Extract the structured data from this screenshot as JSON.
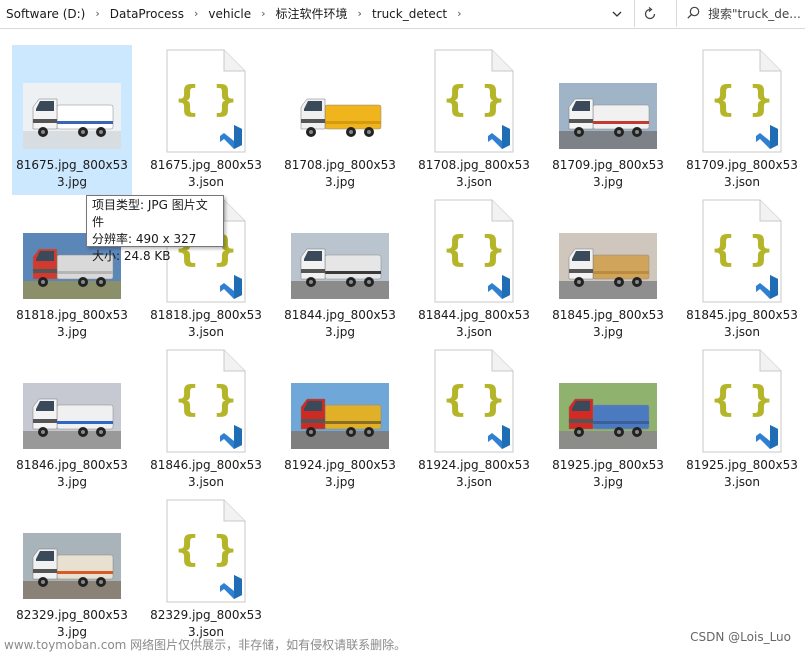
{
  "breadcrumb": [
    "Software (D:)",
    "DataProcess",
    "vehicle",
    "标注软件环境",
    "truck_detect"
  ],
  "search": {
    "placeholder": "搜索\"truck_de..."
  },
  "files": [
    {
      "name": "81675.jpg_800x533.jpg",
      "type": "jpg",
      "selected": true,
      "truck": "white-sweeper"
    },
    {
      "name": "81675.jpg_800x533.json",
      "type": "json"
    },
    {
      "name": "81708.jpg_800x533.jpg",
      "type": "jpg",
      "truck": "yellow-sweeper"
    },
    {
      "name": "81708.jpg_800x533.json",
      "type": "json"
    },
    {
      "name": "81709.jpg_800x533.jpg",
      "type": "jpg",
      "truck": "white-sweeper-2"
    },
    {
      "name": "81709.jpg_800x533.json",
      "type": "json"
    },
    {
      "name": "81818.jpg_800x533.jpg",
      "type": "jpg",
      "truck": "tanker-long"
    },
    {
      "name": "81818.jpg_800x533.json",
      "type": "json"
    },
    {
      "name": "81844.jpg_800x533.jpg",
      "type": "jpg",
      "truck": "white-box"
    },
    {
      "name": "81844.jpg_800x533.json",
      "type": "json"
    },
    {
      "name": "81845.jpg_800x533.jpg",
      "type": "jpg",
      "truck": "white-sweeper-3"
    },
    {
      "name": "81845.jpg_800x533.json",
      "type": "json"
    },
    {
      "name": "81846.jpg_800x533.jpg",
      "type": "jpg",
      "truck": "white-front"
    },
    {
      "name": "81846.jpg_800x533.json",
      "type": "json"
    },
    {
      "name": "81924.jpg_800x533.jpg",
      "type": "jpg",
      "truck": "red-crane"
    },
    {
      "name": "81924.jpg_800x533.json",
      "type": "json"
    },
    {
      "name": "81925.jpg_800x533.jpg",
      "type": "jpg",
      "truck": "red-flatbed"
    },
    {
      "name": "81925.jpg_800x533.json",
      "type": "json"
    },
    {
      "name": "82329.jpg_800x533.jpg",
      "type": "jpg",
      "truck": "white-tanker"
    },
    {
      "name": "82329.jpg_800x533.json",
      "type": "json"
    }
  ],
  "tooltip": {
    "line1": "项目类型: JPG 图片文件",
    "line2": "分辨率: 490 x 327",
    "line3": "大小: 24.8 KB"
  },
  "watermark": "www.toymoban.com 网络图片仅供展示，非存储，如有侵权请联系删除。",
  "credit": "CSDN @Lois_Luo",
  "colors": {
    "selection": "#cce8ff",
    "brace": "#b5b52a",
    "vscode": "#2f80d1"
  },
  "icons": {
    "search": "search-icon",
    "refresh": "refresh-icon",
    "dropdown": "chevron-down-icon"
  }
}
